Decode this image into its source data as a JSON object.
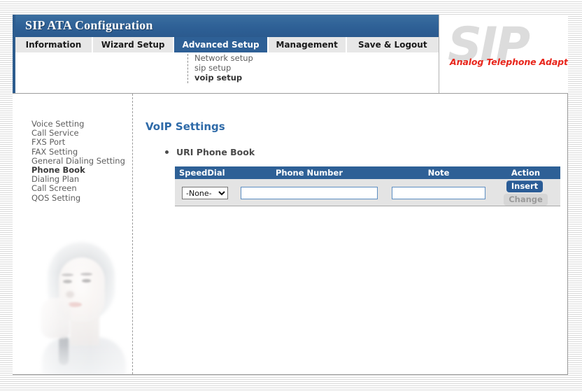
{
  "header": {
    "title": "SIP ATA Configuration",
    "logo_text": "SIP",
    "logo_tagline": "Analog Telephone Adapter"
  },
  "tabs": [
    {
      "label": "Information",
      "active": false
    },
    {
      "label": "Wizard Setup",
      "active": false
    },
    {
      "label": "Advanced Setup",
      "active": true
    },
    {
      "label": "Management",
      "active": false
    },
    {
      "label": "Save & Logout",
      "active": false
    }
  ],
  "submenu": [
    {
      "label": "Network setup",
      "active": false
    },
    {
      "label": "sip setup",
      "active": false
    },
    {
      "label": "voip setup",
      "active": true
    }
  ],
  "sidebar": {
    "items": [
      {
        "label": "Voice Setting",
        "active": false
      },
      {
        "label": "Call Service",
        "active": false
      },
      {
        "label": "FXS Port",
        "active": false
      },
      {
        "label": "FAX Setting",
        "active": false
      },
      {
        "label": "General Dialing Setting",
        "active": false
      },
      {
        "label": "Phone Book",
        "active": true
      },
      {
        "label": "Dialing Plan",
        "active": false
      },
      {
        "label": "Call Screen",
        "active": false
      },
      {
        "label": "QOS Setting",
        "active": false
      }
    ]
  },
  "content": {
    "title": "VoIP Settings",
    "section_label": "URI Phone Book",
    "table": {
      "headers": [
        "SpeedDial",
        "Phone Number",
        "Note",
        "Action"
      ],
      "row": {
        "speeddial_value": "-None-",
        "speeddial_options": [
          "-None-"
        ],
        "phone_number_value": "",
        "phone_number_placeholder": "",
        "note_value": "",
        "note_placeholder": "",
        "insert_label": "Insert",
        "change_label": "Change"
      }
    }
  },
  "colors": {
    "header_blue": "#2e6096",
    "title_blue": "#2e6aa8",
    "accent_red": "#e8251b",
    "row_gray": "#e4e4e4",
    "tab_gray": "#e7e7e7"
  }
}
